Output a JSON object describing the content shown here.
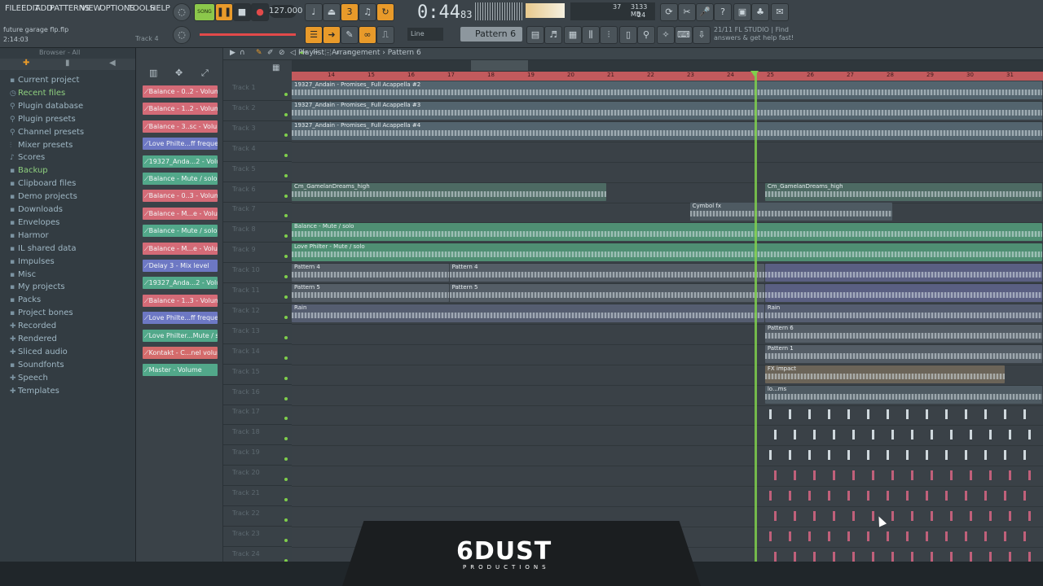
{
  "menu": [
    "FILE",
    "EDIT",
    "ADD",
    "PATTERNS",
    "VIEW",
    "OPTIONS",
    "TOOLS",
    "HELP"
  ],
  "transport": {
    "tempo": "127.000",
    "time_main": "0:44",
    "time_sub": "83",
    "song_label": "SONG"
  },
  "monitor": {
    "cpu": "37",
    "ram": "3133 MB",
    "poly": "24"
  },
  "project": {
    "file": "future garage flp.flp",
    "elapsed": "2:14:03",
    "track_hint": "Track 4"
  },
  "toolbar2": {
    "snap": "Line",
    "pattern": "Pattern 6"
  },
  "hint": {
    "line1": "21/11  FL STUDIO | Find",
    "line2": "answers & get help fast!"
  },
  "browser": {
    "title": "Browser - All",
    "items": [
      {
        "label": "Current project",
        "icon": "folder-icon"
      },
      {
        "label": "Recent files",
        "icon": "clock-icon"
      },
      {
        "label": "Plugin database",
        "icon": "plug-icon"
      },
      {
        "label": "Plugin presets",
        "icon": "plug-icon"
      },
      {
        "label": "Channel presets",
        "icon": "plug-icon"
      },
      {
        "label": "Mixer presets",
        "icon": "mixer-icon"
      },
      {
        "label": "Scores",
        "icon": "note-icon"
      },
      {
        "label": "Backup",
        "icon": "folder-icon"
      },
      {
        "label": "Clipboard files",
        "icon": "folder-icon"
      },
      {
        "label": "Demo projects",
        "icon": "folder-icon"
      },
      {
        "label": "Downloads",
        "icon": "folder-icon"
      },
      {
        "label": "Envelopes",
        "icon": "folder-icon"
      },
      {
        "label": "Harmor",
        "icon": "folder-icon"
      },
      {
        "label": "IL shared data",
        "icon": "folder-icon"
      },
      {
        "label": "Impulses",
        "icon": "folder-icon"
      },
      {
        "label": "Misc",
        "icon": "folder-icon"
      },
      {
        "label": "My projects",
        "icon": "folder-icon"
      },
      {
        "label": "Packs",
        "icon": "folder-icon"
      },
      {
        "label": "Project bones",
        "icon": "folder-icon"
      },
      {
        "label": "Recorded",
        "icon": "plus-icon"
      },
      {
        "label": "Rendered",
        "icon": "plus-icon"
      },
      {
        "label": "Sliced audio",
        "icon": "plus-icon"
      },
      {
        "label": "Soundfonts",
        "icon": "folder-icon"
      },
      {
        "label": "Speech",
        "icon": "plus-icon"
      },
      {
        "label": "Templates",
        "icon": "plus-icon"
      }
    ]
  },
  "channels": [
    {
      "label": "Balance - 0..2 - Volume",
      "color": "#d46b77"
    },
    {
      "label": "Balance - 1..2 - Volume",
      "color": "#d46b77"
    },
    {
      "label": "Balance - 3..sc - Volume",
      "color": "#d46b77"
    },
    {
      "label": "Love Philte...ff frequency",
      "color": "#6d78c4"
    },
    {
      "label": "19327_Anda...2 - Volume",
      "color": "#52a88a"
    },
    {
      "label": "Balance - Mute / solo",
      "color": "#52a88a"
    },
    {
      "label": "Balance - 0..3 - Volume",
      "color": "#d46b77"
    },
    {
      "label": "Balance - M...e - Volume",
      "color": "#d46b77"
    },
    {
      "label": "Balance - Mute / solo",
      "color": "#52a88a"
    },
    {
      "label": "Balance - M...e - Volume",
      "color": "#d46b77"
    },
    {
      "label": "Delay 3 - Mix level",
      "color": "#6d78c4"
    },
    {
      "label": "19327_Anda...2 - Volume",
      "color": "#52a88a"
    },
    {
      "label": "Balance - 1..3 - Volume",
      "color": "#d46b77"
    },
    {
      "label": "Love Philte...ff frequency",
      "color": "#6d78c4"
    },
    {
      "label": "Love Philter...Mute / solo",
      "color": "#52a88a"
    },
    {
      "label": "Kontakt - C...nel volume",
      "color": "#d46b6b"
    },
    {
      "label": "Master - Volume",
      "color": "#52a88a"
    }
  ],
  "playlist": {
    "title": "Playlist - Arrangement",
    "pattern": "Pattern 6"
  },
  "ruler": [
    "14",
    "15",
    "16",
    "17",
    "18",
    "19",
    "20",
    "21",
    "22",
    "23",
    "24",
    "25",
    "26",
    "27",
    "28",
    "29",
    "30",
    "31"
  ],
  "tracks": [
    "Track 1",
    "Track 2",
    "Track 3",
    "Track 4",
    "Track 5",
    "Track 6",
    "Track 7",
    "Track 8",
    "Track 9",
    "Track 10",
    "Track 11",
    "Track 12",
    "Track 13",
    "Track 14",
    "Track 15",
    "Track 16",
    "Track 17",
    "Track 18",
    "Track 19",
    "Track 20",
    "Track 21",
    "Track 22",
    "Track 23",
    "Track 24"
  ],
  "clips": [
    {
      "track": 0,
      "start": 0,
      "end": 1,
      "label": "19327_Andain - Promises_ Full Acappella #2",
      "color": "#53646e"
    },
    {
      "track": 1,
      "start": 0,
      "end": 1,
      "label": "19327_Andain - Promises_ Full Acappella #3",
      "color": "#53646e"
    },
    {
      "track": 2,
      "start": 0,
      "end": 1,
      "label": "19327_Andain - Promises_ Full Acappella #4",
      "color": "#53646e"
    },
    {
      "track": 5,
      "start": 0,
      "end": 0.42,
      "label": "Cm_GamelanDreams_high",
      "color": "#4d6a63"
    },
    {
      "track": 5,
      "start": 0.63,
      "end": 1,
      "label": "Cm_GamelanDreams_high",
      "color": "#4d6a63"
    },
    {
      "track": 6,
      "start": 0.53,
      "end": 0.8,
      "label": "Cymbol fx",
      "color": "#4e5a62"
    },
    {
      "track": 7,
      "start": 0,
      "end": 1,
      "label": "Balance - Mute / solo",
      "color": "#4f8f73"
    },
    {
      "track": 8,
      "start": 0,
      "end": 1,
      "label": "Love Philter - Mute / solo",
      "color": "#4f8f73"
    },
    {
      "track": 9,
      "start": 0,
      "end": 0.21,
      "label": "Pattern 4",
      "color": "#545d66"
    },
    {
      "track": 9,
      "start": 0.21,
      "end": 0.63,
      "label": "Pattern 4",
      "color": "#545d66"
    },
    {
      "track": 9,
      "start": 0.63,
      "end": 1,
      "label": "",
      "color": "#5a5f82"
    },
    {
      "track": 10,
      "start": 0,
      "end": 0.21,
      "label": "Pattern 5",
      "color": "#545d66"
    },
    {
      "track": 10,
      "start": 0.21,
      "end": 0.63,
      "label": "Pattern 5",
      "color": "#545d66"
    },
    {
      "track": 10,
      "start": 0.63,
      "end": 1,
      "label": "",
      "color": "#5a5f82"
    },
    {
      "track": 11,
      "start": 0,
      "end": 0.63,
      "label": "Rain",
      "color": "#555d70"
    },
    {
      "track": 11,
      "start": 0.63,
      "end": 1,
      "label": "Rain",
      "color": "#555d70"
    },
    {
      "track": 12,
      "start": 0.63,
      "end": 1,
      "label": "Pattern 6",
      "color": "#545d66"
    },
    {
      "track": 13,
      "start": 0.63,
      "end": 1,
      "label": "Pattern 1",
      "color": "#545d66"
    },
    {
      "track": 14,
      "start": 0.63,
      "end": 0.95,
      "label": "FX impact",
      "color": "#6b6458"
    },
    {
      "track": 15,
      "start": 0.63,
      "end": 1,
      "label": "lo...ms",
      "color": "#4e5a62"
    }
  ],
  "logo": {
    "main": "6DUST",
    "sub": "PRODUCTIONS"
  }
}
